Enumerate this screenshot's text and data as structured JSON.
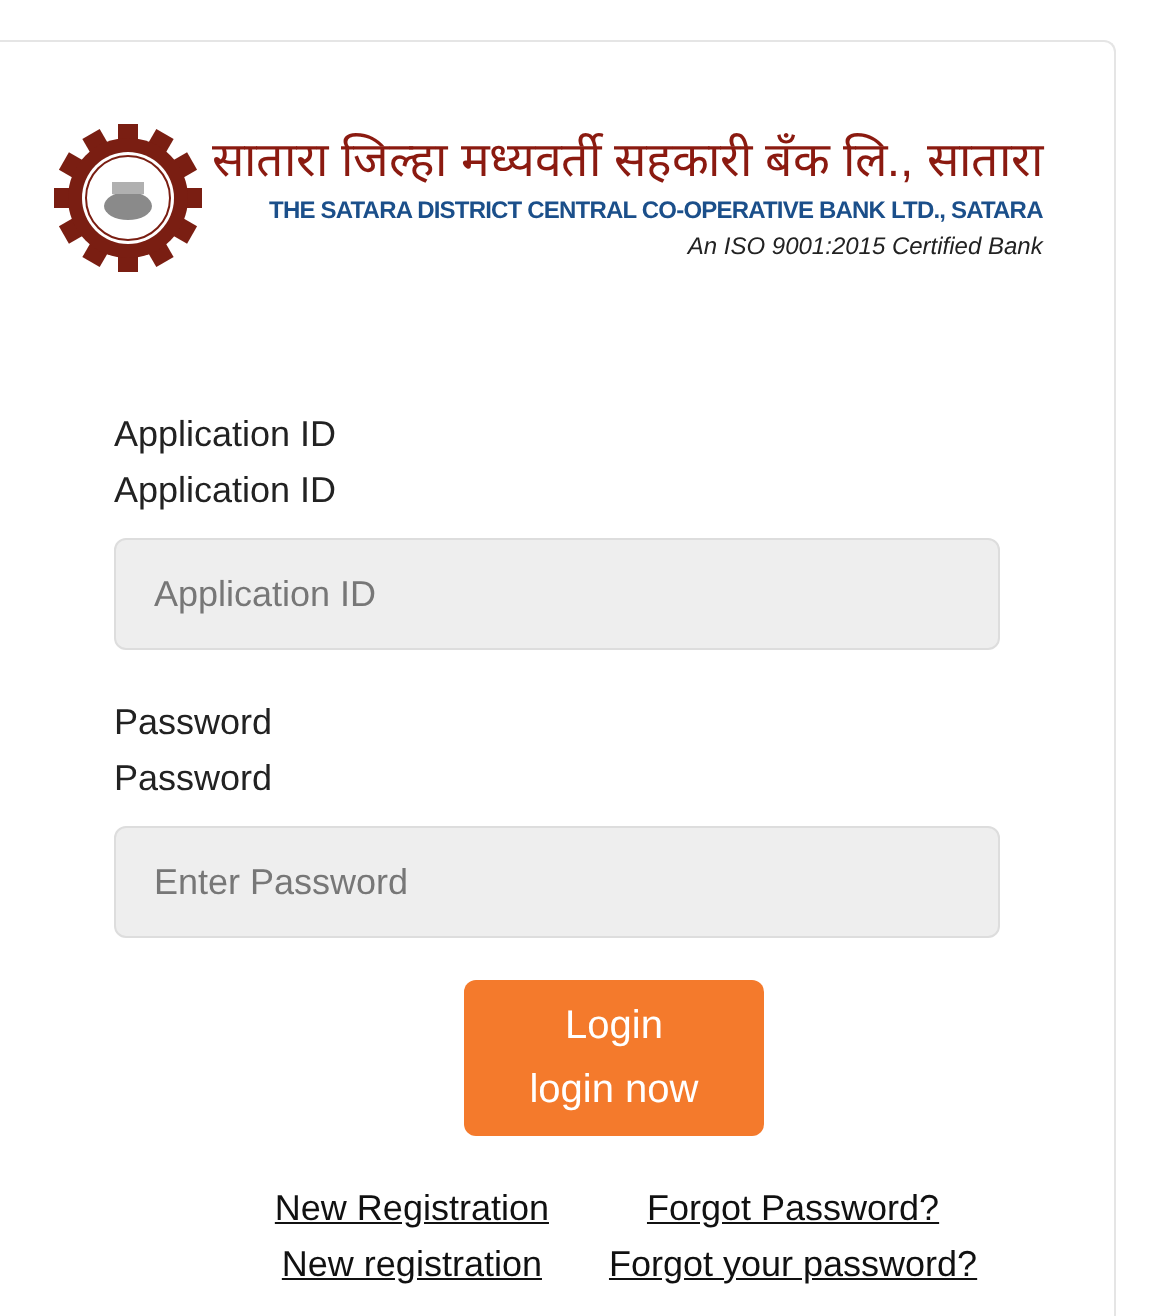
{
  "logo": {
    "marathi_name": "सातारा जिल्हा मध्यवर्ती सहकारी बँक लि., सातारा",
    "english_name": "THE SATARA DISTRICT CENTRAL CO-OPERATIVE BANK LTD., SATARA",
    "tagline": "An ISO 9001:2015 Certified Bank"
  },
  "fields": [
    {
      "label": "Application ID",
      "sublabel": "Application ID",
      "placeholder": "Application ID"
    },
    {
      "label": "Password",
      "sublabel": "Password",
      "placeholder": "Enter Password"
    }
  ],
  "login_button": {
    "label": "Login",
    "sublabel": "login now"
  },
  "links": [
    {
      "label": "New Registration",
      "sublabel": "New registration"
    },
    {
      "label": "Forgot Password?",
      "sublabel": "Forgot your password?"
    }
  ]
}
